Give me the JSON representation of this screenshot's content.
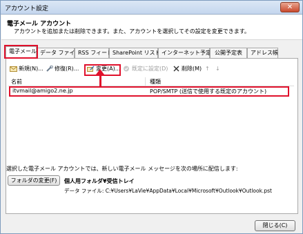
{
  "window": {
    "title": "アカウント設定",
    "close_label": "✕"
  },
  "header": {
    "title": "電子メール アカウント",
    "description": "アカウントを追加または削除できます。また、アカウントを選択してその設定を変更できます。"
  },
  "tabs": [
    {
      "label": "電子メール"
    },
    {
      "label": "データ ファイル"
    },
    {
      "label": "RSS フィード"
    },
    {
      "label": "SharePoint リスト"
    },
    {
      "label": "インターネット予定表"
    },
    {
      "label": "公開予定表"
    },
    {
      "label": "アドレス帳"
    }
  ],
  "toolbar": {
    "new_label": "新規(N)...",
    "repair_label": "修復(R)...",
    "change_label": "変更(A)...",
    "default_label": "既定に設定(D)",
    "delete_label": "削除(M)",
    "up_label": "↑",
    "down_label": "↓"
  },
  "list": {
    "columns": [
      "名前",
      "種類"
    ],
    "rows": [
      {
        "name": "itvmail@amigo2.ne.jp",
        "type": "POP/SMTP (送信で使用する既定のアカウント)"
      }
    ]
  },
  "delivery": {
    "text": "選択した電子メール アカウントでは、新しい電子メール メッセージを次の場所に配信します:",
    "button_label": "フォルダの変更(F)",
    "folder": "個人用フォルダ¥受信トレイ",
    "data_file": "データ ファイル: C:¥Users¥LaVie¥AppData¥Local¥Microsoft¥Outlook¥Outlook.pst"
  },
  "footer": {
    "close_label": "閉じる(C)"
  },
  "colors": {
    "highlight": "#e0102b",
    "titlebar": "#c4d6ee"
  }
}
